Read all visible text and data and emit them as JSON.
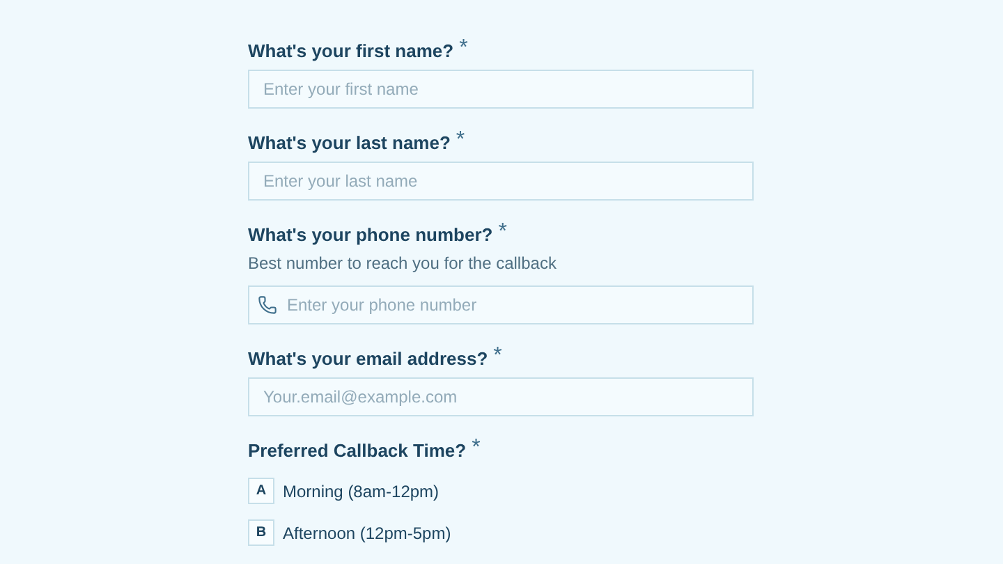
{
  "questions": [
    {
      "kind": "text",
      "label": "What's your first name?",
      "required_mark": "*",
      "placeholder": "Enter your first name"
    },
    {
      "kind": "text",
      "label": "What's your last name?",
      "required_mark": "*",
      "placeholder": "Enter your last name"
    },
    {
      "kind": "phone",
      "label": "What's your phone number?",
      "required_mark": "*",
      "description": "Best number to reach you for the callback",
      "placeholder": "Enter your phone number"
    },
    {
      "kind": "text",
      "label": "What's your email address?",
      "required_mark": "*",
      "placeholder": "Your.email@example.com"
    },
    {
      "kind": "choice",
      "label": "Preferred Callback Time?",
      "required_mark": "*",
      "options": [
        {
          "key": "A",
          "label": "Morning (8am-12pm)",
          "selected": false
        },
        {
          "key": "B",
          "label": "Afternoon (12pm-5pm)",
          "selected": false
        }
      ]
    }
  ]
}
